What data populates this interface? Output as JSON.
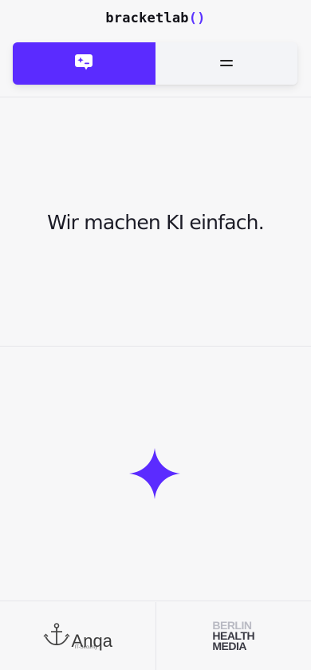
{
  "header": {
    "logo_text": "bracketlab",
    "logo_brackets": "()",
    "nav": {
      "chat_button_icon": "chat-sparkle-icon",
      "menu_button_icon": "menu-icon"
    }
  },
  "hero": {
    "title": "Wir machen KI einfach."
  },
  "spark": {
    "icon": "sparkle-icon",
    "color": "#5b2bff"
  },
  "footer": {
    "logos": [
      {
        "name": "Anqa",
        "sub": "IT-Security"
      },
      {
        "name_lines": [
          "BERLIN",
          "HEALTH",
          "MEDIA"
        ]
      }
    ]
  },
  "colors": {
    "accent": "#5b2bff",
    "background": "#f7f7f8",
    "text": "#1c1c27"
  }
}
